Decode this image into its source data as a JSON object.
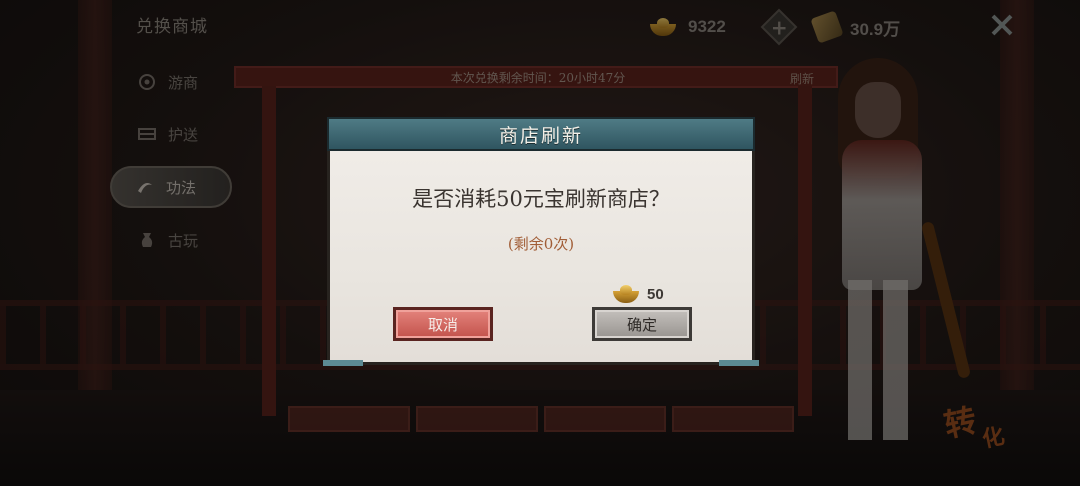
{
  "shop": {
    "title": "兑换商城",
    "timer_text": "本次兑换剩余时间：20小时47分",
    "refresh_label": "刷新"
  },
  "sidebar": {
    "items": [
      {
        "label": "游商",
        "icon": "merchant-icon",
        "active": false
      },
      {
        "label": "护送",
        "icon": "escort-icon",
        "active": false
      },
      {
        "label": "功法",
        "icon": "technique-icon",
        "active": true
      },
      {
        "label": "古玩",
        "icon": "antique-icon",
        "active": false
      }
    ]
  },
  "currencies": {
    "gold_ingot": "9322",
    "token": "30.9万"
  },
  "modal": {
    "title": "商店刷新",
    "question": "是否消耗50元宝刷新商店？",
    "remaining": "(剩余0次)",
    "cost_amount": "50",
    "cancel_label": "取消",
    "confirm_label": "确定"
  },
  "badge": {
    "char1": "转",
    "char2": "化"
  },
  "colors": {
    "modal_header": "#3f6b75",
    "cancel_button": "#d46a63",
    "confirm_button": "#b3afab",
    "remaining_text": "#a15d36"
  }
}
